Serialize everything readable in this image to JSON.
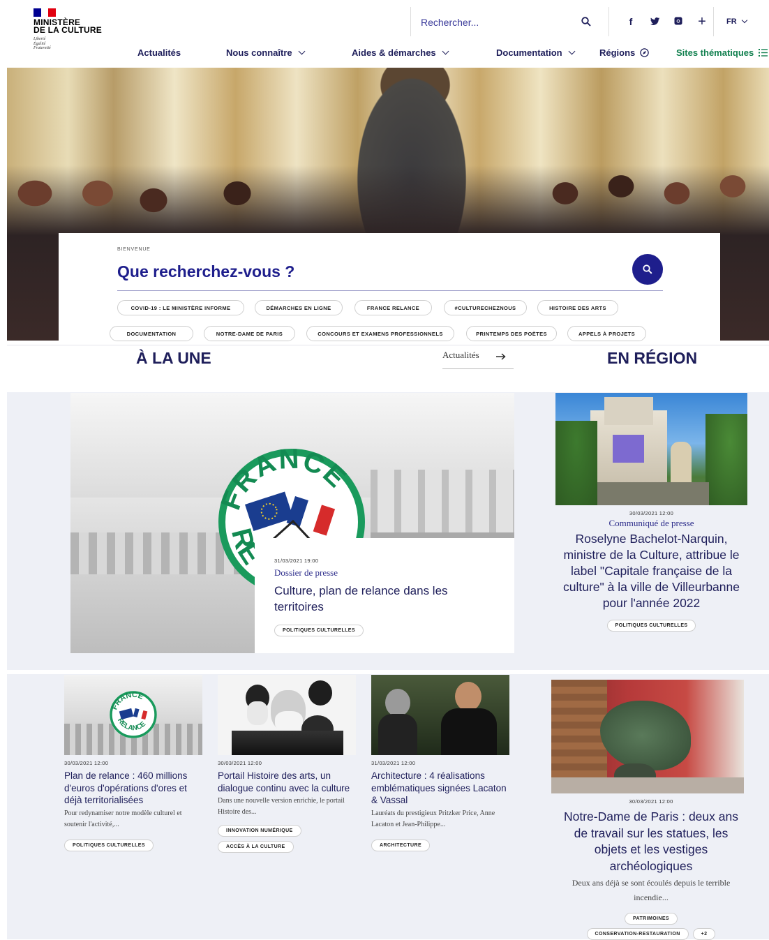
{
  "brand": {
    "title": "MINISTÈRE\nDE LA CULTURE",
    "motto": "Liberté\nÉgalité\nFraternité",
    "flag_colors": [
      "#000091",
      "#ffffff",
      "#e1000f"
    ]
  },
  "search": {
    "placeholder": "Rechercher..."
  },
  "socials": [
    {
      "icon": "facebook-icon",
      "glyph": "f"
    },
    {
      "icon": "twitter-icon",
      "glyph": "🐦"
    },
    {
      "icon": "instagram-icon",
      "glyph": "◙"
    },
    {
      "icon": "plus-icon",
      "glyph": "+"
    }
  ],
  "language": {
    "label": "FR"
  },
  "nav": {
    "actualites": "Actualités",
    "nous_connaitre": "Nous connaître",
    "aides": "Aides & démarches",
    "documentation": "Documentation",
    "regions": "Régions",
    "sites": "Sites thématiques"
  },
  "hero": {
    "kicker": "BIENVENUE",
    "title": "Que recherchez-vous ?",
    "chips": [
      "COVID-19 : LE MINISTÈRE INFORME",
      "DÉMARCHES EN LIGNE",
      "FRANCE RELANCE",
      "#CULTURECHEZNOUS",
      "HISTOIRE DES ARTS",
      "DOCUMENTATION",
      "NOTRE-DAME DE PARIS",
      "CONCOURS ET EXAMENS PROFESSIONNELS",
      "PRINTEMPS DES POÈTES",
      "APPELS À PROJETS"
    ]
  },
  "sections": {
    "a_la_une": "À LA UNE",
    "actualites_link": "Actualités",
    "en_region": "EN RÉGION"
  },
  "featured": {
    "date": "31/03/2021 19:00",
    "kind": "Dossier de presse",
    "title": "Culture, plan de relance dans les territoires",
    "tag": "POLITIQUES CULTURELLES",
    "logo_text_top": "FRANCE",
    "logo_text_bottom": "RE"
  },
  "region": {
    "date": "30/03/2021 12:00",
    "kind": "Communiqué de presse",
    "title": "Roselyne Bachelot-Narquin, ministre de la Culture, attribue le label \"Capitale française de la culture\" à la ville de Villeurbanne pour l'année 2022",
    "tag": "POLITIQUES CULTURELLES"
  },
  "cards": [
    {
      "date": "30/03/2021 12:00",
      "title": "Plan de relance : 460 millions d'euros d'opérations d'ores et déjà territorialisées",
      "excerpt": "Pour redynamiser notre modèle culturel et soutenir l'activité,...",
      "tags": [
        "POLITIQUES CULTURELLES"
      ],
      "logo_top": "FRANCE",
      "logo_bottom": "RELANCE"
    },
    {
      "date": "30/03/2021 12:00",
      "title": "Portail Histoire des arts, un dialogue continu avec la culture",
      "excerpt": "Dans une nouvelle version enrichie, le portail Histoire des...",
      "tags": [
        "INNOVATION NUMÉRIQUE",
        "ACCÈS À LA CULTURE"
      ]
    },
    {
      "date": "31/03/2021 12:00",
      "title": "Architecture : 4 réalisations emblématiques signées Lacaton & Vassal",
      "excerpt": "Lauréats du prestigieux Pritzker Price, Anne Lacaton et Jean-Philippe...",
      "tags": [
        "ARCHITECTURE"
      ]
    }
  ],
  "region_card2": {
    "date": "30/03/2021 12:00",
    "title": "Notre-Dame de Paris : deux ans de travail sur les statues, les objets et les vestiges archéologiques",
    "excerpt": "Deux ans déjà se sont écoulés depuis le terrible incendie...",
    "tags": [
      "PATRIMOINES",
      "CONSERVATION-RESTAURATION",
      "+2"
    ]
  },
  "colors": {
    "navy": "#1e1e8c",
    "text": "#1e1e5a",
    "green": "#12804f",
    "panel": "#eef0f6"
  }
}
